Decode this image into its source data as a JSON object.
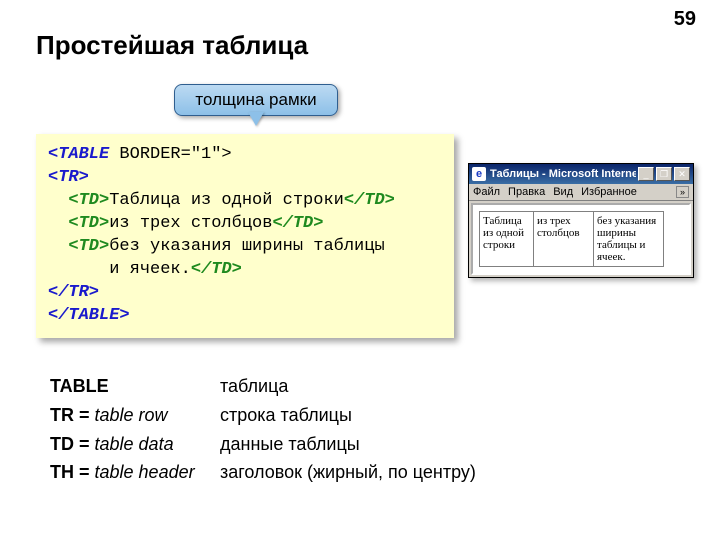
{
  "page_number": "59",
  "heading": "Простейшая таблица",
  "callout": "толщина рамки",
  "code": {
    "table_open_a": "<TABLE",
    "table_open_b": " BORDER=\"1\">",
    "tr_open": "<TR>",
    "td_open": "<TD>",
    "td_close": "</TD>",
    "line1_text": "Таблица из одной строки",
    "line2_text": "из трех столбцов",
    "line3_text": "без указания ширины таблицы",
    "line4_text": "и ячеек.",
    "tr_close": "</TR>",
    "table_close": "</TABLE>"
  },
  "ie": {
    "title": "Таблицы - Microsoft Internet E...",
    "menu": {
      "file": "Файл",
      "edit": "Правка",
      "view": "Вид",
      "fav": "Избранное",
      "more": "»"
    },
    "cells": {
      "c1": "Таблица из одной строки",
      "c2": "из трех столбцов",
      "c3": "без указания ширины таблицы и ячеек."
    },
    "btn_min": "_",
    "btn_max": "❐",
    "btn_close": "✕"
  },
  "legend": {
    "table_term": "TABLE",
    "table_def": "таблица",
    "tr_term_a": "TR = ",
    "tr_term_b": "table row",
    "tr_def": "строка таблицы",
    "td_term_a": "TD = ",
    "td_term_b": "table data",
    "td_def": "данные таблицы",
    "th_term_a": "TH = ",
    "th_term_b": "table header",
    "th_def": "заголовок (жирный, по центру)"
  }
}
